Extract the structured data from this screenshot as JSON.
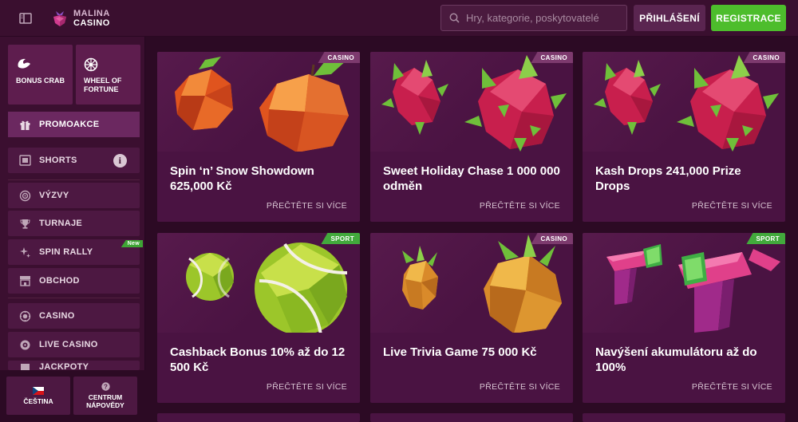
{
  "header": {
    "logo_line1": "MALINA",
    "logo_line2": "CASINO",
    "search_placeholder": "Hry, kategorie, poskytovatelé",
    "login_label": "PŘIHLÁŠENÍ",
    "register_label": "REGISTRACE"
  },
  "sidebar": {
    "tiles": [
      {
        "label": "BONUS CRAB",
        "icon": "crab-claw-icon"
      },
      {
        "label": "WHEEL OF FORTUNE",
        "icon": "wheel-icon"
      }
    ],
    "items": [
      {
        "label": "PROMOAKCE",
        "icon": "gift-icon"
      },
      {
        "label": "SHORTS",
        "icon": "film-icon"
      },
      {
        "label": "VÝZVY",
        "icon": "target-icon"
      },
      {
        "label": "TURNAJE",
        "icon": "trophy-icon"
      },
      {
        "label": "SPIN RALLY",
        "icon": "sparkle-icon",
        "badge": "New"
      },
      {
        "label": "OBCHOD",
        "icon": "shop-icon"
      },
      {
        "label": "CASINO",
        "icon": "chips-icon"
      },
      {
        "label": "LIVE CASINO",
        "icon": "roulette-icon"
      },
      {
        "label": "JACKPOTY",
        "icon": "jackpot-icon"
      }
    ],
    "bottom": [
      {
        "label": "ČEŠTINA",
        "icon": "cz-flag-icon"
      },
      {
        "label": "CENTRUM NÁPOVĚDY",
        "icon": "help-icon"
      }
    ]
  },
  "cards": [
    {
      "title": "Spin ‘n’ Snow Showdown 625,000 Kč",
      "category": "CASINO",
      "more": "PŘEČTĚTE SI VÍCE",
      "art": "orange"
    },
    {
      "title": "Sweet Holiday Chase 1 000 000 odměn",
      "category": "CASINO",
      "more": "PŘEČTĚTE SI VÍCE",
      "art": "dragonfruit"
    },
    {
      "title": "Kash Drops 241,000 Prize Drops",
      "category": "CASINO",
      "more": "PŘEČTĚTE SI VÍCE",
      "art": "dragonfruit"
    },
    {
      "title": "Cashback Bonus 10% až do 12 500 Kč",
      "category": "SPORT",
      "more": "PŘEČTĚTE SI VÍCE",
      "art": "tennis"
    },
    {
      "title": "Live Trivia Game 75 000 Kč",
      "category": "CASINO",
      "more": "PŘEČTĚTE SI VÍCE",
      "art": "pineapple"
    },
    {
      "title": "Navýšení akumulátoru až do 100%",
      "category": "SPORT",
      "more": "PŘEČTĚTE SI VÍCE",
      "art": "moneygun"
    }
  ],
  "colors": {
    "accent_green": "#4dbd2c",
    "casino_tag": "#7d3a6e",
    "sport_tag": "#42a93c"
  }
}
